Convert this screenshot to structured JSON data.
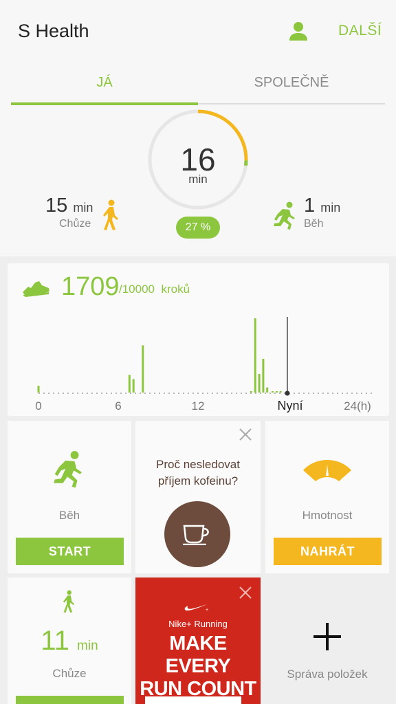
{
  "header": {
    "title": "S Health",
    "profile_icon": "person-icon",
    "more_label": "DALŠÍ"
  },
  "tabs": [
    {
      "label": "JÁ",
      "active": true
    },
    {
      "label": "SPOLEČNĚ",
      "active": false
    }
  ],
  "activity": {
    "total_value": "16",
    "total_unit": "min",
    "percent_label": "27 %",
    "percent": 27,
    "walking": {
      "value": "15",
      "unit": "min",
      "label": "Chůze",
      "icon": "walking-icon"
    },
    "running": {
      "value": "1",
      "unit": "min",
      "label": "Běh",
      "icon": "running-icon"
    }
  },
  "steps": {
    "icon": "shoe-icon",
    "count": "1709",
    "goal": "/10000",
    "unit": "kroků",
    "axis_labels": [
      "0",
      "6",
      "12",
      "Nyní",
      "24(h)"
    ],
    "chart_data": {
      "type": "bar",
      "xlabel": "",
      "ylabel": "",
      "x_unit": "h",
      "xlim": [
        0,
        24
      ],
      "now_hour": 18.6,
      "bars": [
        {
          "hour": 0.0,
          "steps": 40
        },
        {
          "hour": 6.8,
          "steps": 105
        },
        {
          "hour": 7.1,
          "steps": 80
        },
        {
          "hour": 7.8,
          "steps": 280
        },
        {
          "hour": 15.9,
          "steps": 5
        },
        {
          "hour": 16.2,
          "steps": 440
        },
        {
          "hour": 16.5,
          "steps": 110
        },
        {
          "hour": 16.8,
          "steps": 200
        },
        {
          "hour": 17.1,
          "steps": 30
        },
        {
          "hour": 17.5,
          "steps": 5
        },
        {
          "hour": 17.8,
          "steps": 5
        },
        {
          "hour": 18.1,
          "steps": 5
        }
      ]
    }
  },
  "tiles": {
    "run": {
      "label": "Běh",
      "button": "START",
      "icon": "running-icon"
    },
    "coffee": {
      "question": "Proč nesledovat příjem kofeinu?",
      "icon": "coffee-cup-icon",
      "close_icon": "close-icon"
    },
    "weight": {
      "label": "Hmotnost",
      "button": "NAHRÁT",
      "icon": "scale-gauge-icon"
    },
    "walk": {
      "value": "11",
      "unit": "min",
      "label": "Chůze",
      "icon": "walking-icon"
    },
    "nike": {
      "brand": "Nike+ Running",
      "headline_1": "MAKE EVERY",
      "headline_2": "RUN COUNT",
      "logo": "nike-swoosh-icon",
      "close_icon": "close-icon"
    },
    "manage": {
      "label": "Správa položek",
      "icon": "plus-icon"
    }
  },
  "colors": {
    "accent": "#8cc63f",
    "walking": "#f4b71f",
    "coffee": "#6d4c3d",
    "nike": "#d0271d",
    "weight_button": "#f4b71f"
  }
}
